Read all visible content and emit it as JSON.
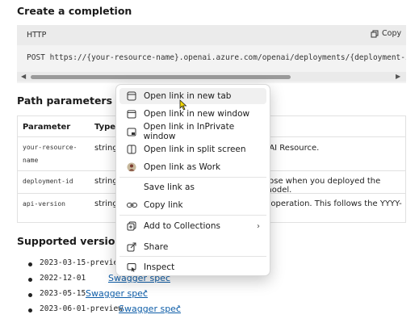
{
  "heading_create": "Create a completion",
  "code": {
    "lang": "HTTP",
    "copy_label": "Copy",
    "line": "POST https://{your-resource-name}.openai.azure.com/openai/deployments/{deployment-id}/co"
  },
  "path_params": {
    "heading": "Path parameters",
    "col_parameter": "Parameter",
    "col_type": "Type",
    "rows": [
      {
        "name_line1": "your-resource-",
        "name_line2": "name",
        "type": "string",
        "desc": "nAI Resource."
      },
      {
        "name_line1": "deployment-id",
        "type": "string",
        "desc": "oose when you deployed the model."
      },
      {
        "name_line1": "api-version",
        "type": "string",
        "desc": "s operation. This follows the YYYY-"
      }
    ]
  },
  "versions": {
    "heading": "Supported versions",
    "items": [
      {
        "code": "2023-03-15-preview",
        "link": ""
      },
      {
        "code": "2022-12-01",
        "link": "Swagger spec"
      },
      {
        "code": "2023-05-15",
        "link": "Swagger spec"
      },
      {
        "code": "2023-06-01-preview",
        "link": "Swagger spec"
      }
    ]
  },
  "context_menu": {
    "items": [
      {
        "label": "Open link in new tab",
        "icon": "new-tab-icon"
      },
      {
        "label": "Open link in new window",
        "icon": "new-window-icon"
      },
      {
        "label": "Open link in InPrivate window",
        "icon": "inprivate-window-icon"
      },
      {
        "label": "Open link in split screen",
        "icon": "split-screen-icon"
      },
      {
        "label": "Open link as Work",
        "icon": "work-profile-icon"
      },
      {
        "label": "Save link as",
        "icon": ""
      },
      {
        "label": "Copy link",
        "icon": "link-icon"
      },
      {
        "label": "Add to Collections",
        "icon": "collections-icon"
      },
      {
        "label": "Share",
        "icon": "share-icon"
      },
      {
        "label": "Inspect",
        "icon": "inspect-icon"
      }
    ]
  }
}
